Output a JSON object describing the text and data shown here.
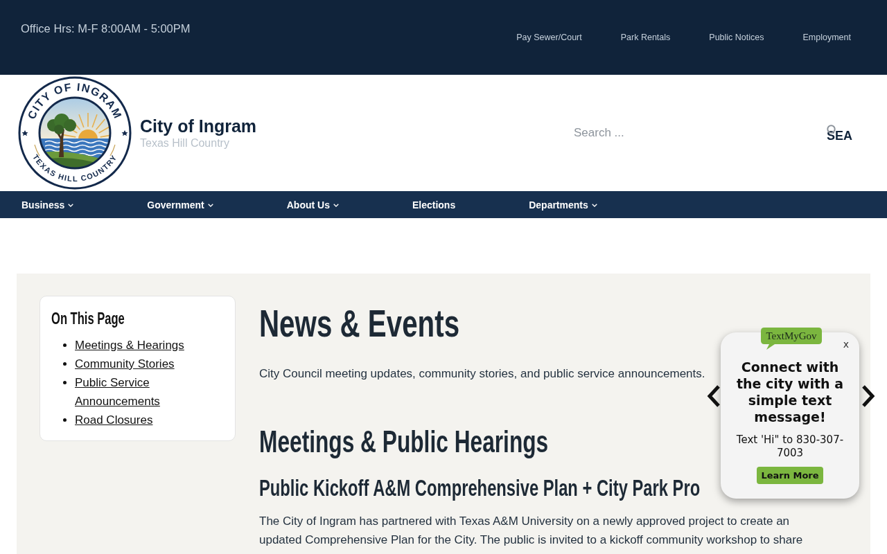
{
  "top_bar": {
    "office_hours": "Office Hrs: M-F 8:00AM - 5:00PM",
    "links": [
      "Pay Sewer/Court",
      "Park Rentals",
      "Public Notices",
      "Employment"
    ]
  },
  "header": {
    "logo": {
      "top_text": "CITY OF INGRAM",
      "bottom_text": "TEXAS HILL COUNTRY"
    },
    "site_title": "City of Ingram",
    "tagline": "Texas Hill Country",
    "search": {
      "placeholder": "Search ...",
      "button": "SEA"
    }
  },
  "nav": [
    {
      "label": "Business",
      "dropdown": true
    },
    {
      "label": "Government",
      "dropdown": true
    },
    {
      "label": "About Us",
      "dropdown": true
    },
    {
      "label": "Elections",
      "dropdown": false
    },
    {
      "label": "Departments",
      "dropdown": true
    }
  ],
  "sidebar": {
    "title": "On This Page",
    "links": [
      "Meetings & Hearings",
      "Community Stories",
      "Public Service Announcements",
      "Road Closures"
    ]
  },
  "main": {
    "title": "News & Events",
    "intro": "City Council meeting updates, community stories, and public service announcements.",
    "section_title": "Meetings & Public Hearings",
    "article_title": "Public Kickoff A&M Comprehensive Plan + City Park Pro",
    "article_lines": [
      "The City of Ingram has partnered with Texas A&M University on a newly approved project to create an",
      "updated Comprehensive Plan for the City. The public is invited to a kickoff community workshop to share"
    ]
  },
  "popup": {
    "badge": "TextMyGov",
    "close": "x",
    "heading": "Connect with the city with a simple text message!",
    "text": "Text 'Hi\" to 830-307-7003",
    "button": "Learn More"
  }
}
